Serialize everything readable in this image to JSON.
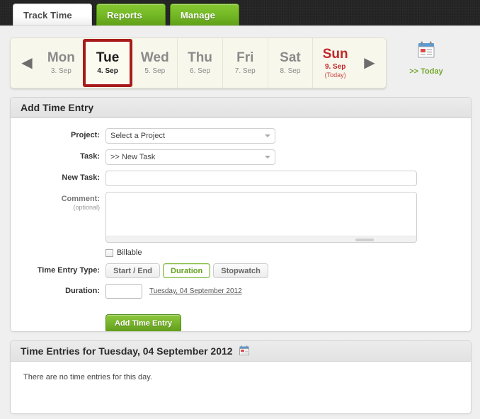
{
  "nav": {
    "tabs": [
      {
        "label": "Track Time",
        "active": true
      },
      {
        "label": "Reports",
        "active": false
      },
      {
        "label": "Manage",
        "active": false
      }
    ]
  },
  "day_selector": {
    "prev_arrow": "◀",
    "next_arrow": "▶",
    "today_link": ">> Today",
    "today_icon": "calendar-icon",
    "days": [
      {
        "dow": "Mon",
        "date": "3. Sep",
        "selected": false,
        "weekend": false,
        "today": false,
        "today_note": ""
      },
      {
        "dow": "Tue",
        "date": "4. Sep",
        "selected": true,
        "weekend": false,
        "today": false,
        "today_note": ""
      },
      {
        "dow": "Wed",
        "date": "5. Sep",
        "selected": false,
        "weekend": false,
        "today": false,
        "today_note": ""
      },
      {
        "dow": "Thu",
        "date": "6. Sep",
        "selected": false,
        "weekend": false,
        "today": false,
        "today_note": ""
      },
      {
        "dow": "Fri",
        "date": "7. Sep",
        "selected": false,
        "weekend": false,
        "today": false,
        "today_note": ""
      },
      {
        "dow": "Sat",
        "date": "8. Sep",
        "selected": false,
        "weekend": false,
        "today": false,
        "today_note": ""
      },
      {
        "dow": "Sun",
        "date": "9. Sep",
        "selected": false,
        "weekend": true,
        "today": true,
        "today_note": "(Today)"
      }
    ]
  },
  "add_entry": {
    "title": "Add Time Entry",
    "project": {
      "label": "Project:",
      "value": "Select a Project",
      "options": [
        "Select a Project"
      ]
    },
    "task": {
      "label": "Task:",
      "value": ">> New Task",
      "options": [
        ">> New Task"
      ]
    },
    "new_task": {
      "label": "New Task:",
      "value": "",
      "placeholder": ""
    },
    "comment": {
      "label": "Comment:",
      "sub_label": "(optional)",
      "value": "",
      "placeholder": ""
    },
    "billable": {
      "label": "Billable",
      "checked": false
    },
    "time_entry_type": {
      "label": "Time Entry Type:",
      "options": [
        {
          "label": "Start / End",
          "active": false
        },
        {
          "label": "Duration",
          "active": true
        },
        {
          "label": "Stopwatch",
          "active": false
        }
      ]
    },
    "duration": {
      "label": "Duration:",
      "value": "",
      "placeholder": "",
      "date_link": "Tuesday, 04 September 2012"
    },
    "submit_label": "Add Time Entry"
  },
  "entries": {
    "title": "Time Entries for Tuesday, 04 September 2012",
    "icon": "calendar-icon",
    "empty_message": "There are no time entries for this day."
  },
  "colors": {
    "accent_green": "#76bb27",
    "selected_day_border": "#a81b1b",
    "today_red": "#c0282b",
    "link_green": "#76a832",
    "header_dark": "#262626"
  }
}
